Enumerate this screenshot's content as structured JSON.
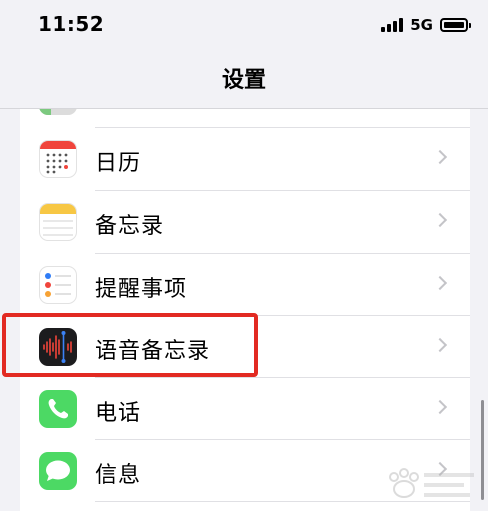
{
  "status_bar": {
    "time": "11:52",
    "network": "5G",
    "icons": [
      "signal-icon",
      "battery-icon"
    ]
  },
  "nav": {
    "title": "设置"
  },
  "settings_items": [
    {
      "label": "日历",
      "icon": "calendar-icon",
      "color": "#ffffff"
    },
    {
      "label": "备忘录",
      "icon": "notes-icon",
      "color": "#f7c744"
    },
    {
      "label": "提醒事项",
      "icon": "reminders-icon",
      "color": "#ffffff"
    },
    {
      "label": "语音备忘录",
      "icon": "voice-memos-icon",
      "color": "#1c1c1e"
    },
    {
      "label": "电话",
      "icon": "phone-icon",
      "color": "#4cd964"
    },
    {
      "label": "信息",
      "icon": "messages-icon",
      "color": "#4cd964"
    }
  ],
  "colors": {
    "background": "#f2f2f6",
    "highlight": "#e22a22",
    "chevron": "#c4c4c8"
  }
}
